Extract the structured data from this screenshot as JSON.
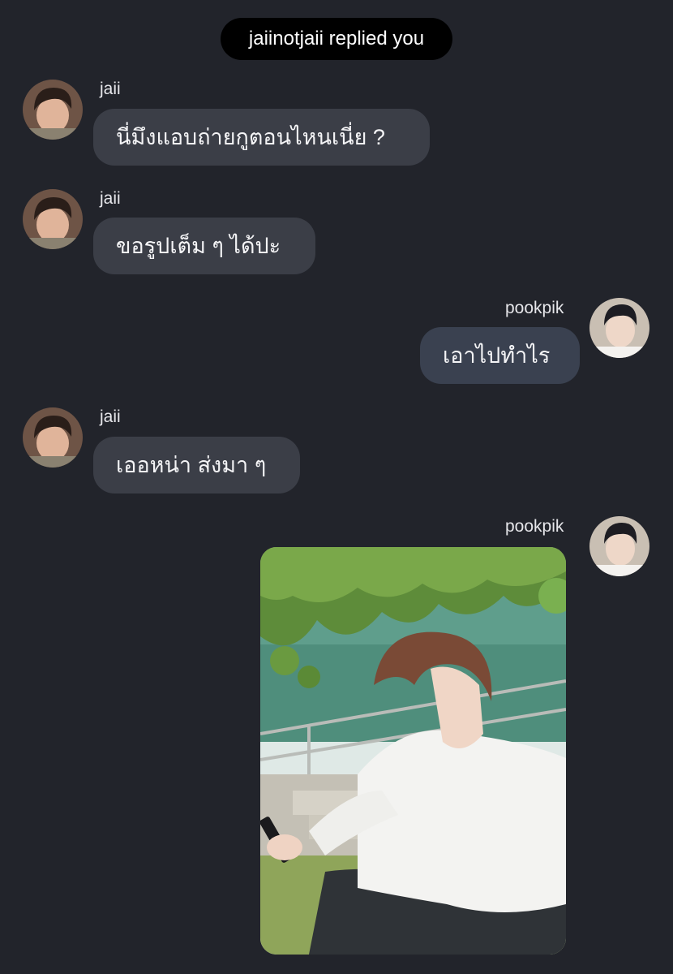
{
  "notice": {
    "text": "jaiinotjaii replied you"
  },
  "messages": [
    {
      "sender": "jaii",
      "text": "นี่มึงแอบถ่ายกูตอนไหนเนี่ย ?"
    },
    {
      "sender": "jaii",
      "text": "ขอรูปเต็ม ๆ ได้ปะ"
    },
    {
      "sender": "pookpik",
      "text": "เอาไปทำไร"
    },
    {
      "sender": "jaii",
      "text": "เออหน่า ส่งมา ๆ"
    },
    {
      "sender": "pookpik",
      "attachment": "photo"
    }
  ],
  "colors": {
    "background": "#22242b",
    "incoming_bubble": "#3b3e47",
    "outgoing_bubble": "#3a4150",
    "notice_pill": "#000000"
  }
}
